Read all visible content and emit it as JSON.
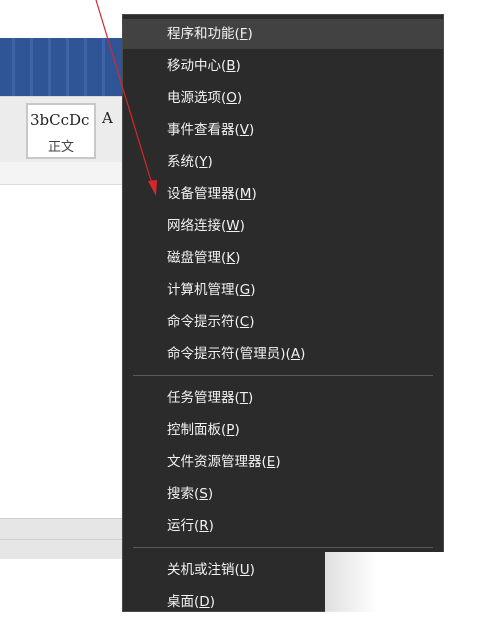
{
  "background": {
    "style_samples": [
      {
        "sample": "3bCcDc",
        "name": "正文"
      },
      {
        "sample": "A",
        "name": ""
      }
    ]
  },
  "menu": {
    "groups": [
      [
        {
          "label": "程序和功能",
          "key": "F"
        },
        {
          "label": "移动中心",
          "key": "B"
        },
        {
          "label": "电源选项",
          "key": "O"
        },
        {
          "label": "事件查看器",
          "key": "V"
        },
        {
          "label": "系统",
          "key": "Y"
        },
        {
          "label": "设备管理器",
          "key": "M"
        },
        {
          "label": "网络连接",
          "key": "W"
        },
        {
          "label": "磁盘管理",
          "key": "K"
        },
        {
          "label": "计算机管理",
          "key": "G"
        },
        {
          "label": "命令提示符",
          "key": "C"
        },
        {
          "label": "命令提示符(管理员)",
          "key": "A"
        }
      ],
      [
        {
          "label": "任务管理器",
          "key": "T"
        },
        {
          "label": "控制面板",
          "key": "P"
        },
        {
          "label": "文件资源管理器",
          "key": "E"
        },
        {
          "label": "搜索",
          "key": "S"
        },
        {
          "label": "运行",
          "key": "R"
        }
      ],
      [
        {
          "label": "关机或注销",
          "key": "U",
          "submenu": true
        },
        {
          "label": "桌面",
          "key": "D"
        }
      ]
    ],
    "hovered_index": 0,
    "annotation_target": "设备管理器",
    "colors": {
      "menu_bg": "#2b2b2b",
      "hover_bg": "#424242",
      "text": "#f2f2f2",
      "arrow": "#d9262c"
    }
  }
}
